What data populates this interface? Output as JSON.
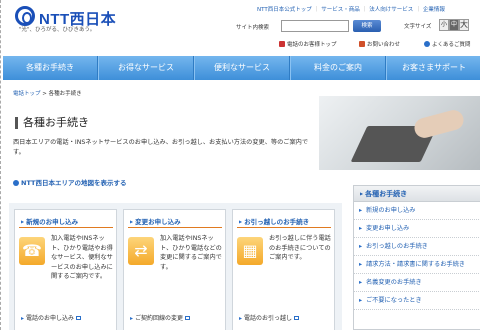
{
  "header": {
    "logo_text": "NTT西日本",
    "tagline": "\"光\"、ひろがる、ひびきあう。",
    "toplinks": [
      "NTT西日本公式トップ",
      "サービス・商品",
      "法人向けサービス",
      "企業情報"
    ],
    "search_label": "サイト内検索",
    "search_placeholder": "",
    "search_button": "検索",
    "fontsize_label": "文字サイズ",
    "fontsize_small": "小",
    "fontsize_mid": "中",
    "fontsize_large": "大",
    "sublinks": [
      "電話のお客様トップ",
      "お問い合わせ",
      "よくあるご質問"
    ]
  },
  "nav": {
    "items": [
      "各種お手続き",
      "お得なサービス",
      "便利なサービス",
      "料金のご案内",
      "お客さまサポート"
    ]
  },
  "breadcrumb": {
    "home": "電話トップ",
    "separator": " > ",
    "current": "各種お手続き"
  },
  "main": {
    "title": "各種お手続き",
    "intro": "西日本エリアの電話・INSネットサービスのお申し込み、お引っ越し、お支払い方法の変更、等のご案内です。",
    "map_link": "NTT西日本エリアの地図を表示する"
  },
  "cards": [
    {
      "title": "新規のお申し込み",
      "icon": "phone-icon",
      "text": "加入電話やINSネット、ひかり電話やお得なサービス、便利なサービスのお申し込みに関するご案内です。",
      "link": "電話のお申し込み"
    },
    {
      "title": "変更お申し込み",
      "icon": "exchange-icon",
      "text": "加入電話やINSネット、ひかり電話などの変更に関するご案内です。",
      "link": "ご契約回線の変更"
    },
    {
      "title": "お引っ越しのお手続き",
      "icon": "building-icon",
      "text": "お引っ越しに伴う電話のお手続きについてのご案内です。",
      "link": "電話のお引っ越し"
    }
  ],
  "sidebar": {
    "heading": "各種お手続き",
    "items": [
      "新規のお申し込み",
      "変更お申し込み",
      "お引っ越しのお手続き",
      "請求方法・請求書に関するお手続き",
      "名義変更のお手続き",
      "ご不要になったとき"
    ]
  }
}
